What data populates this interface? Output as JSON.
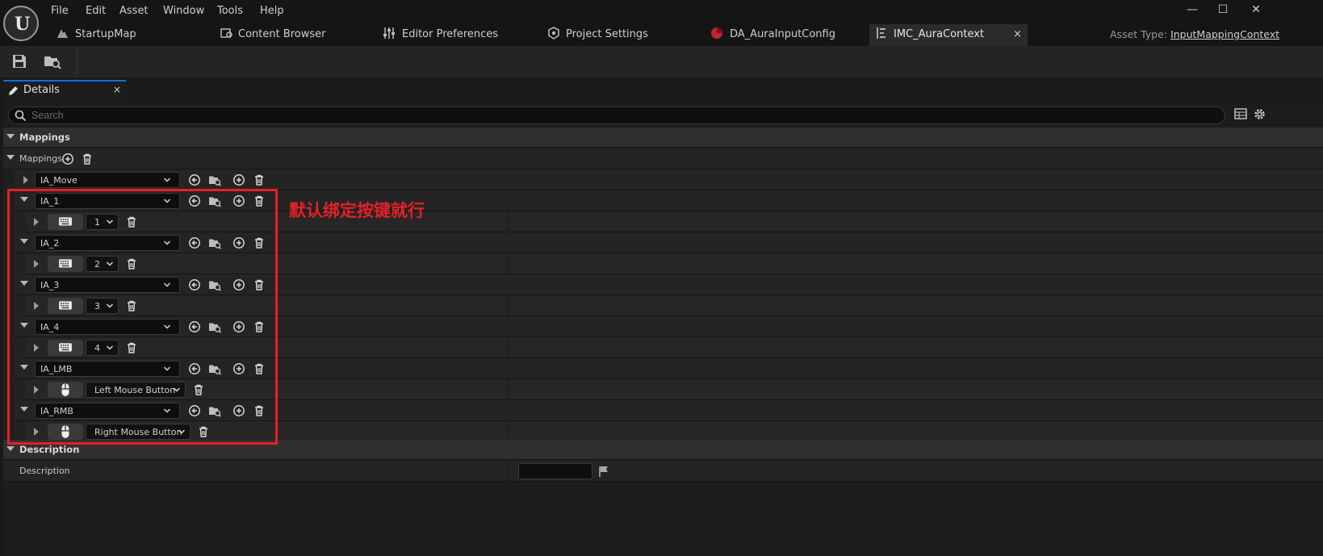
{
  "menu": [
    "File",
    "Edit",
    "Asset",
    "Window",
    "Tools",
    "Help"
  ],
  "window_controls": {
    "minimize": "—",
    "maximize": "☐",
    "close": "✕"
  },
  "tabs": [
    {
      "label": "StartupMap",
      "icon": "map-icon"
    },
    {
      "label": "Content Browser",
      "icon": "content-browser-icon"
    },
    {
      "label": "Editor Preferences",
      "icon": "sliders-icon"
    },
    {
      "label": "Project Settings",
      "icon": "project-settings-icon"
    },
    {
      "label": "DA_AuraInputConfig",
      "icon": "data-asset-icon"
    },
    {
      "label": "IMC_AuraContext",
      "icon": "input-mapping-icon",
      "active": true,
      "close": "×"
    }
  ],
  "asset_type": {
    "label": "Asset Type:",
    "value": "InputMappingContext"
  },
  "toolbar": {
    "save_icon": "save-icon",
    "browse_icon": "browse-to-asset-icon"
  },
  "details": {
    "tab_label": "Details",
    "tab_close": "×",
    "search_placeholder": "Search",
    "categories": {
      "mappings": "Mappings",
      "description": "Description"
    },
    "mappings_label": "Mappings",
    "mappings": [
      {
        "action": "IA_Move",
        "expanded": false,
        "key_device": "keyboard",
        "key": ""
      },
      {
        "action": "IA_1",
        "expanded": true,
        "key_device": "keyboard",
        "key": "1"
      },
      {
        "action": "IA_2",
        "expanded": true,
        "key_device": "keyboard",
        "key": "2"
      },
      {
        "action": "IA_3",
        "expanded": true,
        "key_device": "keyboard",
        "key": "3"
      },
      {
        "action": "IA_4",
        "expanded": true,
        "key_device": "keyboard",
        "key": "4"
      },
      {
        "action": "IA_LMB",
        "expanded": true,
        "key_device": "mouse",
        "key": "Left Mouse Button"
      },
      {
        "action": "IA_RMB",
        "expanded": true,
        "key_device": "mouse",
        "key": "Right Mouse Button"
      }
    ],
    "description_label": "Description",
    "description_value": ""
  },
  "annotation": {
    "text": "默认绑定按键就行",
    "color": "#e3202a"
  },
  "colors": {
    "accent": "#0d6fe0",
    "background": "#1c1c1c",
    "annotation": "#e3202a"
  }
}
